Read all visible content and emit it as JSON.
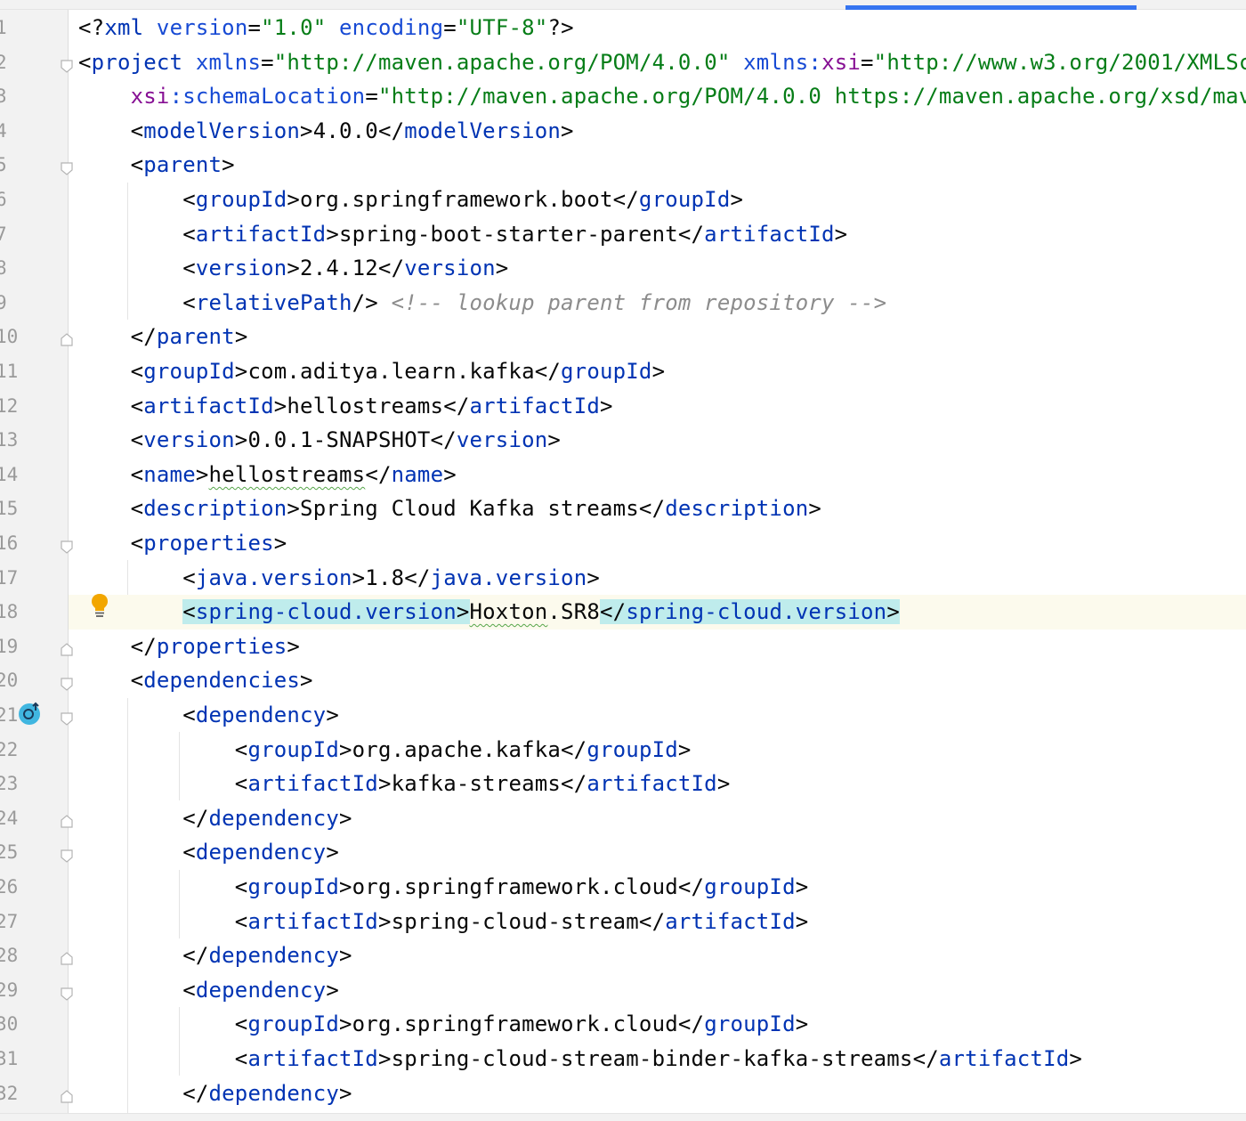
{
  "editor": {
    "file_type": "xml",
    "current_line": 18,
    "colors": {
      "tag": "#0033b3",
      "string": "#067d17",
      "attribute": "#174ad4",
      "namespace": "#871094",
      "comment": "#8c8c8c",
      "text": "#080808",
      "tag_match_highlight": "#bfecec",
      "current_line_background": "#fcfaed",
      "gutter_background": "#f2f2f2"
    },
    "gutter_icons": {
      "intention": "lightbulb-icon",
      "override": "override-up-arrow-icon"
    }
  },
  "lines": [
    {
      "num": "1",
      "fold": "",
      "tokens": [
        [
          "p",
          "<?"
        ],
        [
          "t",
          "xml"
        ],
        [
          "p",
          " "
        ],
        [
          "a",
          "version"
        ],
        [
          "p",
          "="
        ],
        [
          "s",
          "\"1.0\""
        ],
        [
          "p",
          " "
        ],
        [
          "a",
          "encoding"
        ],
        [
          "p",
          "="
        ],
        [
          "s",
          "\"UTF-8\""
        ],
        [
          "p",
          "?>"
        ]
      ]
    },
    {
      "num": "2",
      "fold": "open",
      "tokens": [
        [
          "p",
          "<"
        ],
        [
          "t",
          "project"
        ],
        [
          "p",
          " "
        ],
        [
          "a",
          "xmlns"
        ],
        [
          "p",
          "="
        ],
        [
          "s",
          "\"http://maven.apache.org/POM/4.0.0\""
        ],
        [
          "p",
          " "
        ],
        [
          "a",
          "xmlns:"
        ],
        [
          "ns",
          "xsi"
        ],
        [
          "p",
          "="
        ],
        [
          "s",
          "\"http://www.w3.org/2001/XMLSc"
        ]
      ]
    },
    {
      "num": "3",
      "fold": "",
      "tokens": [
        [
          "p",
          "    "
        ],
        [
          "ns",
          "xsi"
        ],
        [
          "a",
          ":schemaLocation"
        ],
        [
          "p",
          "="
        ],
        [
          "s",
          "\"http://maven.apache.org/POM/4.0.0 https://maven.apache.org/xsd/mav"
        ]
      ]
    },
    {
      "num": "4",
      "fold": "",
      "tokens": [
        [
          "p",
          "    <"
        ],
        [
          "t",
          "modelVersion"
        ],
        [
          "p",
          ">4.0.0</"
        ],
        [
          "t",
          "modelVersion"
        ],
        [
          "p",
          ">"
        ]
      ]
    },
    {
      "num": "5",
      "fold": "open",
      "tokens": [
        [
          "p",
          "    <"
        ],
        [
          "t",
          "parent"
        ],
        [
          "p",
          ">"
        ]
      ]
    },
    {
      "num": "6",
      "fold": "",
      "tokens": [
        [
          "p",
          "        <"
        ],
        [
          "t",
          "groupId"
        ],
        [
          "p",
          ">org.springframework.boot</"
        ],
        [
          "t",
          "groupId"
        ],
        [
          "p",
          ">"
        ]
      ]
    },
    {
      "num": "7",
      "fold": "",
      "tokens": [
        [
          "p",
          "        <"
        ],
        [
          "t",
          "artifactId"
        ],
        [
          "p",
          ">spring-boot-starter-parent</"
        ],
        [
          "t",
          "artifactId"
        ],
        [
          "p",
          ">"
        ]
      ]
    },
    {
      "num": "8",
      "fold": "",
      "tokens": [
        [
          "p",
          "        <"
        ],
        [
          "t",
          "version"
        ],
        [
          "p",
          ">2.4.12</"
        ],
        [
          "t",
          "version"
        ],
        [
          "p",
          ">"
        ]
      ]
    },
    {
      "num": "9",
      "fold": "",
      "tokens": [
        [
          "p",
          "        <"
        ],
        [
          "t",
          "relativePath"
        ],
        [
          "p",
          "/> "
        ],
        [
          "c",
          "<!-- lookup parent from repository -->"
        ]
      ]
    },
    {
      "num": "10",
      "fold": "close",
      "tokens": [
        [
          "p",
          "    </"
        ],
        [
          "t",
          "parent"
        ],
        [
          "p",
          ">"
        ]
      ]
    },
    {
      "num": "11",
      "fold": "",
      "tokens": [
        [
          "p",
          "    <"
        ],
        [
          "t",
          "groupId"
        ],
        [
          "p",
          ">com.aditya.learn.kafka</"
        ],
        [
          "t",
          "groupId"
        ],
        [
          "p",
          ">"
        ]
      ]
    },
    {
      "num": "12",
      "fold": "",
      "tokens": [
        [
          "p",
          "    <"
        ],
        [
          "t",
          "artifactId"
        ],
        [
          "p",
          ">hellostreams</"
        ],
        [
          "t",
          "artifactId"
        ],
        [
          "p",
          ">"
        ]
      ]
    },
    {
      "num": "13",
      "fold": "",
      "tokens": [
        [
          "p",
          "    <"
        ],
        [
          "t",
          "version"
        ],
        [
          "p",
          ">0.0.1-SNAPSHOT</"
        ],
        [
          "t",
          "version"
        ],
        [
          "p",
          ">"
        ]
      ]
    },
    {
      "num": "14",
      "fold": "",
      "tokens": [
        [
          "p",
          "    <"
        ],
        [
          "t",
          "name"
        ],
        [
          "p",
          ">"
        ],
        [
          "pw",
          "hellostreams"
        ],
        [
          "p",
          "</"
        ],
        [
          "t",
          "name"
        ],
        [
          "p",
          ">"
        ]
      ]
    },
    {
      "num": "15",
      "fold": "",
      "tokens": [
        [
          "p",
          "    <"
        ],
        [
          "t",
          "description"
        ],
        [
          "p",
          ">Spring Cloud Kafka streams</"
        ],
        [
          "t",
          "description"
        ],
        [
          "p",
          ">"
        ]
      ]
    },
    {
      "num": "16",
      "fold": "open",
      "tokens": [
        [
          "p",
          "    <"
        ],
        [
          "t",
          "properties"
        ],
        [
          "p",
          ">"
        ]
      ]
    },
    {
      "num": "17",
      "fold": "",
      "tokens": [
        [
          "p",
          "        <"
        ],
        [
          "t",
          "java.version"
        ],
        [
          "p",
          ">1.8</"
        ],
        [
          "t",
          "java.version"
        ],
        [
          "p",
          ">"
        ]
      ]
    },
    {
      "num": "18",
      "fold": "",
      "tokens": [
        [
          "p",
          "        "
        ],
        [
          "ph",
          "<"
        ],
        [
          "th",
          "spring-cloud.version"
        ],
        [
          "ph",
          ">"
        ],
        [
          "pw",
          "Hoxton"
        ],
        [
          "p",
          ".SR8"
        ],
        [
          "ph",
          "</"
        ],
        [
          "th",
          "spring-cloud.version"
        ],
        [
          "ph",
          ">"
        ]
      ]
    },
    {
      "num": "19",
      "fold": "close",
      "tokens": [
        [
          "p",
          "    </"
        ],
        [
          "t",
          "properties"
        ],
        [
          "p",
          ">"
        ]
      ]
    },
    {
      "num": "20",
      "fold": "open",
      "tokens": [
        [
          "p",
          "    <"
        ],
        [
          "t",
          "dependencies"
        ],
        [
          "p",
          ">"
        ]
      ]
    },
    {
      "num": "21",
      "fold": "open",
      "tokens": [
        [
          "p",
          "        <"
        ],
        [
          "t",
          "dependency"
        ],
        [
          "p",
          ">"
        ]
      ]
    },
    {
      "num": "22",
      "fold": "",
      "tokens": [
        [
          "p",
          "            <"
        ],
        [
          "t",
          "groupId"
        ],
        [
          "p",
          ">org.apache.kafka</"
        ],
        [
          "t",
          "groupId"
        ],
        [
          "p",
          ">"
        ]
      ]
    },
    {
      "num": "23",
      "fold": "",
      "tokens": [
        [
          "p",
          "            <"
        ],
        [
          "t",
          "artifactId"
        ],
        [
          "p",
          ">kafka-streams</"
        ],
        [
          "t",
          "artifactId"
        ],
        [
          "p",
          ">"
        ]
      ]
    },
    {
      "num": "24",
      "fold": "close",
      "tokens": [
        [
          "p",
          "        </"
        ],
        [
          "t",
          "dependency"
        ],
        [
          "p",
          ">"
        ]
      ]
    },
    {
      "num": "25",
      "fold": "open",
      "tokens": [
        [
          "p",
          "        <"
        ],
        [
          "t",
          "dependency"
        ],
        [
          "p",
          ">"
        ]
      ]
    },
    {
      "num": "26",
      "fold": "",
      "tokens": [
        [
          "p",
          "            <"
        ],
        [
          "t",
          "groupId"
        ],
        [
          "p",
          ">org.springframework.cloud</"
        ],
        [
          "t",
          "groupId"
        ],
        [
          "p",
          ">"
        ]
      ]
    },
    {
      "num": "27",
      "fold": "",
      "tokens": [
        [
          "p",
          "            <"
        ],
        [
          "t",
          "artifactId"
        ],
        [
          "p",
          ">spring-cloud-stream</"
        ],
        [
          "t",
          "artifactId"
        ],
        [
          "p",
          ">"
        ]
      ]
    },
    {
      "num": "28",
      "fold": "close",
      "tokens": [
        [
          "p",
          "        </"
        ],
        [
          "t",
          "dependency"
        ],
        [
          "p",
          ">"
        ]
      ]
    },
    {
      "num": "29",
      "fold": "open",
      "tokens": [
        [
          "p",
          "        <"
        ],
        [
          "t",
          "dependency"
        ],
        [
          "p",
          ">"
        ]
      ]
    },
    {
      "num": "30",
      "fold": "",
      "tokens": [
        [
          "p",
          "            <"
        ],
        [
          "t",
          "groupId"
        ],
        [
          "p",
          ">org.springframework.cloud</"
        ],
        [
          "t",
          "groupId"
        ],
        [
          "p",
          ">"
        ]
      ]
    },
    {
      "num": "31",
      "fold": "",
      "tokens": [
        [
          "p",
          "            <"
        ],
        [
          "t",
          "artifactId"
        ],
        [
          "p",
          ">spring-cloud-stream-binder-kafka-streams</"
        ],
        [
          "t",
          "artifactId"
        ],
        [
          "p",
          ">"
        ]
      ]
    },
    {
      "num": "32",
      "fold": "close",
      "tokens": [
        [
          "p",
          "        </"
        ],
        [
          "t",
          "dependency"
        ],
        [
          "p",
          ">"
        ]
      ]
    }
  ]
}
